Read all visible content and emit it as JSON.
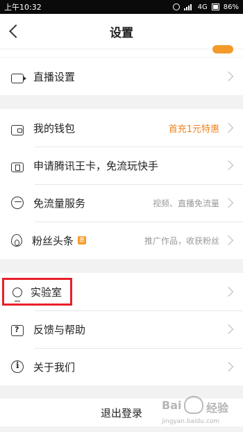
{
  "status_bar": {
    "time": "上午10:32",
    "network": "4G",
    "battery": "86%"
  },
  "nav": {
    "title": "设置"
  },
  "group1": [
    {
      "label": "直播设置",
      "icon": "broadcast-icon"
    }
  ],
  "group2": [
    {
      "label": "我的钱包",
      "sub": "首充1元特惠",
      "icon": "wallet-icon"
    },
    {
      "label": "申请腾讯王卡，免流玩快手",
      "sub": "",
      "icon": "card-icon"
    },
    {
      "label": "免流量服务",
      "sub": "视频、直播免流量",
      "icon": "traffic-icon"
    },
    {
      "label": "粉丝头条",
      "badge": "惠",
      "sub": "推广作品，收获粉丝",
      "icon": "fire-icon"
    }
  ],
  "group3": [
    {
      "label": "实验室",
      "icon": "lightbulb-icon"
    },
    {
      "label": "反馈与帮助",
      "icon": "feedback-icon"
    },
    {
      "label": "关于我们",
      "icon": "info-icon"
    }
  ],
  "logout": {
    "label": "退出登录"
  },
  "watermark": {
    "text1": "Bai",
    "text2": "经验",
    "sub": "jingyan.baidu.com"
  },
  "colors": {
    "accent": "#f0821e",
    "highlight": "#e8202a"
  }
}
